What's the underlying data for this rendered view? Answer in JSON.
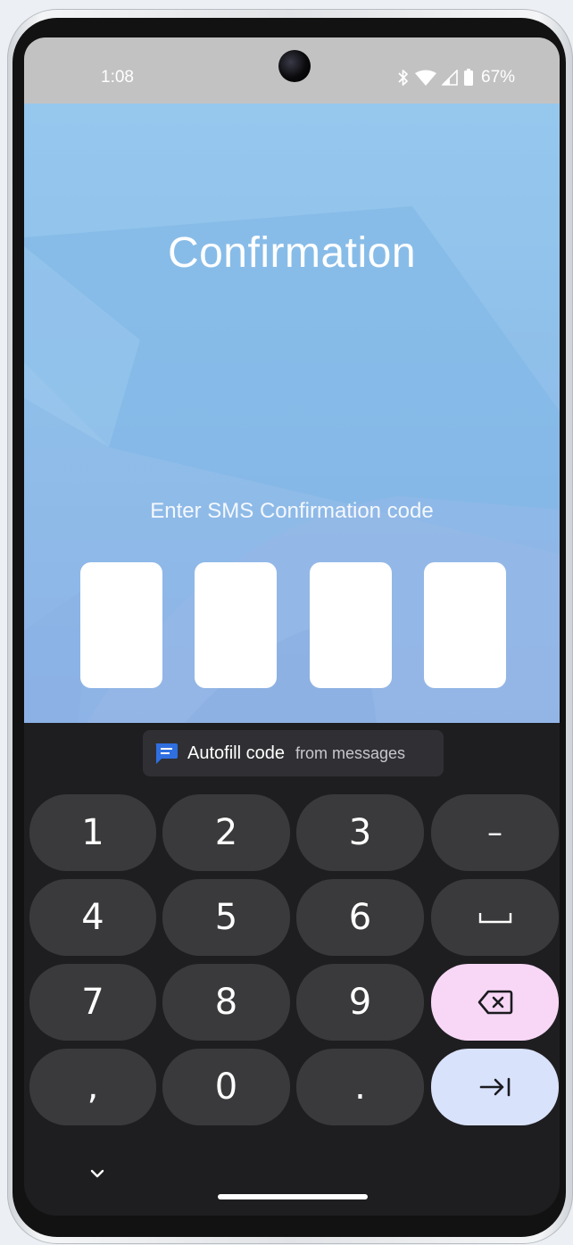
{
  "status_bar": {
    "time": "1:08",
    "battery": "67%",
    "icons": [
      "bluetooth-icon",
      "wifi-icon",
      "cell-signal-icon",
      "battery-icon"
    ]
  },
  "screen": {
    "title": "Confirmation",
    "subtitle": "Enter SMS Confirmation code",
    "code_boxes": [
      "",
      "",
      "",
      ""
    ]
  },
  "keyboard": {
    "autofill": {
      "main": "Autofill code",
      "sub": "from messages",
      "icon": "message-icon"
    },
    "keys": {
      "1": "1",
      "2": "2",
      "3": "3",
      "4": "4",
      "5": "5",
      "6": "6",
      "7": "7",
      "8": "8",
      "9": "9",
      "comma": ",",
      "0": "0",
      "period": ".",
      "minus": "–",
      "space": "␣"
    },
    "icons": [
      "backspace-icon",
      "tab-icon",
      "chevron-down-icon"
    ]
  },
  "colors": {
    "background_top": "#96c8ee",
    "keyboard_bg": "#1e1e20",
    "key_bg": "#3a3a3c",
    "backspace_key": "#f8d7f6",
    "enter_key": "#d9e2fb",
    "autofill_icon": "#2f6fe0"
  }
}
